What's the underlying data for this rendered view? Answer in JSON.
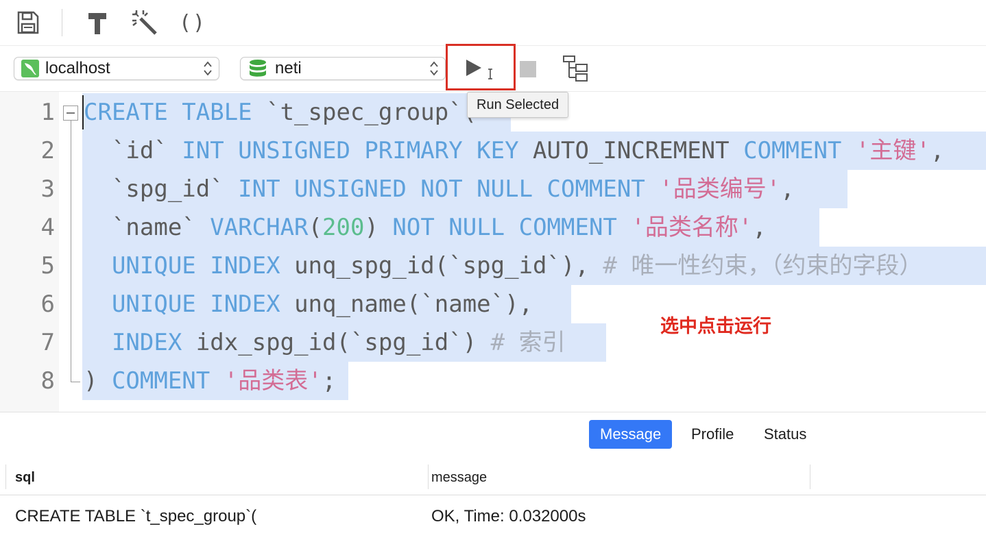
{
  "toolbar": {
    "icons": [
      "save-icon",
      "beautify-hammer-icon",
      "magic-wand-icon",
      "parentheses-icon"
    ],
    "paren_text": "()"
  },
  "connection": {
    "server": "localhost",
    "database": "neti"
  },
  "run": {
    "tooltip": "Run Selected"
  },
  "editor": {
    "line_numbers": [
      "1",
      "2",
      "3",
      "4",
      "5",
      "6",
      "7",
      "8"
    ],
    "lines": [
      [
        {
          "t": "CREATE TABLE",
          "c": "kw"
        },
        {
          "t": " `t_spec_group`(",
          "c": "pl"
        }
      ],
      [
        {
          "t": "  `id` ",
          "c": "pl"
        },
        {
          "t": "INT UNSIGNED PRIMARY KEY",
          "c": "kw"
        },
        {
          "t": " AUTO_INCREMENT ",
          "c": "pl"
        },
        {
          "t": "COMMENT",
          "c": "kw"
        },
        {
          "t": " ",
          "c": "pl"
        },
        {
          "t": "'主键'",
          "c": "str"
        },
        {
          "t": ",",
          "c": "pl"
        }
      ],
      [
        {
          "t": "  `spg_id` ",
          "c": "pl"
        },
        {
          "t": "INT UNSIGNED NOT NULL COMMENT",
          "c": "kw"
        },
        {
          "t": " ",
          "c": "pl"
        },
        {
          "t": "'品类编号'",
          "c": "str"
        },
        {
          "t": ",",
          "c": "pl"
        }
      ],
      [
        {
          "t": "  `name` ",
          "c": "pl"
        },
        {
          "t": "VARCHAR",
          "c": "kw"
        },
        {
          "t": "(",
          "c": "pl"
        },
        {
          "t": "200",
          "c": "num"
        },
        {
          "t": ") ",
          "c": "pl"
        },
        {
          "t": "NOT NULL COMMENT",
          "c": "kw"
        },
        {
          "t": " ",
          "c": "pl"
        },
        {
          "t": "'品类名称'",
          "c": "str"
        },
        {
          "t": ",",
          "c": "pl"
        }
      ],
      [
        {
          "t": "  ",
          "c": "pl"
        },
        {
          "t": "UNIQUE INDEX",
          "c": "kw"
        },
        {
          "t": " unq_spg_id(`spg_id`), ",
          "c": "pl"
        },
        {
          "t": "# 唯一性约束，（约束的字段）",
          "c": "cm"
        }
      ],
      [
        {
          "t": "  ",
          "c": "pl"
        },
        {
          "t": "UNIQUE INDEX",
          "c": "kw"
        },
        {
          "t": " unq_name(`name`),",
          "c": "pl"
        }
      ],
      [
        {
          "t": "  ",
          "c": "pl"
        },
        {
          "t": "INDEX",
          "c": "kw"
        },
        {
          "t": " idx_spg_id(`spg_id`) ",
          "c": "pl"
        },
        {
          "t": "# 索引",
          "c": "cm"
        }
      ],
      [
        {
          "t": ") ",
          "c": "pl"
        },
        {
          "t": "COMMENT",
          "c": "kw"
        },
        {
          "t": " ",
          "c": "pl"
        },
        {
          "t": "'品类表'",
          "c": "str"
        },
        {
          "t": ";",
          "c": "pl"
        }
      ]
    ]
  },
  "annotation": "选中点击运行",
  "tabs": [
    {
      "label": "Message",
      "active": true
    },
    {
      "label": "Profile",
      "active": false
    },
    {
      "label": "Status",
      "active": false
    }
  ],
  "results": {
    "columns": [
      "sql",
      "message"
    ],
    "rows": [
      [
        "CREATE TABLE `t_spec_group`(",
        "OK, Time: 0.032000s"
      ]
    ]
  },
  "colors": {
    "keyword": "#5ea1dc",
    "string": "#d36d95",
    "number": "#5bbd8e",
    "comment": "#a9afba",
    "selection": "#dbe7fa",
    "accent": "#3478f6",
    "annotation": "#e02a1f"
  }
}
